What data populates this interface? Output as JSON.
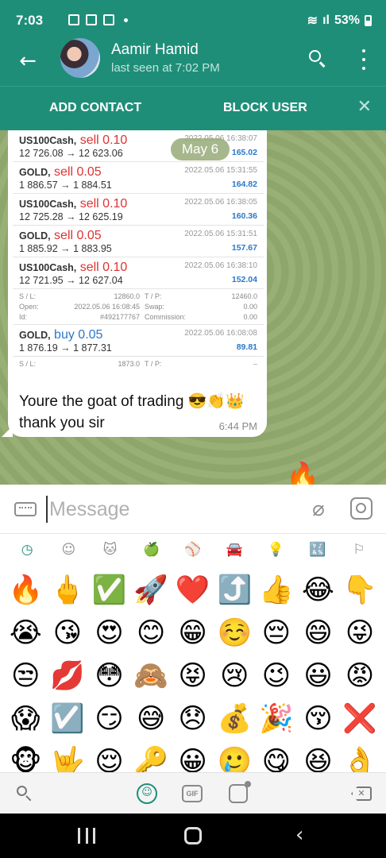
{
  "status_bar": {
    "time": "7:03",
    "battery": "53%"
  },
  "header": {
    "contact_name": "Aamir Hamid",
    "last_seen": "last seen at 7:02 PM"
  },
  "action_bar": {
    "add_contact": "ADD CONTACT",
    "block_user": "BLOCK USER"
  },
  "chat": {
    "date_chip": "May 6",
    "image_trades": [
      {
        "symbol": "US100Cash,",
        "direction": "sell 0.10",
        "prices": "12 726.08 → 12 623.06",
        "time": "2022.05.06 16:38:07",
        "profit": "165.02"
      },
      {
        "symbol": "GOLD,",
        "direction": "sell 0.05",
        "prices": "1 886.57 → 1 884.51",
        "time": "2022.05.06 15:31:55",
        "profit": "164.82"
      },
      {
        "symbol": "US100Cash,",
        "direction": "sell 0.10",
        "prices": "12 725.28 → 12 625.19",
        "time": "2022.05.06 16:38:05",
        "profit": "160.36"
      },
      {
        "symbol": "GOLD,",
        "direction": "sell 0.05",
        "prices": "1 885.92 → 1 883.95",
        "time": "2022.05.06 15:31:51",
        "profit": "157.67"
      },
      {
        "symbol": "US100Cash,",
        "direction": "sell 0.10",
        "prices": "12 721.95 → 12 627.04",
        "time": "2022.05.06 16:38:10",
        "profit": "152.04"
      }
    ],
    "trade_details": {
      "sl_label": "S / L:",
      "sl_value": "12860.0",
      "tp_label": "T / P:",
      "tp_value": "12460.0",
      "open_label": "Open:",
      "open_value": "2022.05.06 16:08:45",
      "swap_label": "Swap:",
      "swap_value": "0.00",
      "id_label": "Id:",
      "id_value": "#492177767",
      "commission_label": "Commission:",
      "commission_value": "0.00"
    },
    "last_trade": {
      "symbol": "GOLD,",
      "direction": "buy 0.05",
      "prices": "1 876.19 → 1 877.31",
      "time": "2022.05.06 16:08:08",
      "profit": "89.81"
    },
    "last_trade_details": {
      "sl_label": "S / L:",
      "sl_value": "1873.0",
      "tp_label": "T / P:",
      "tp_value": "–"
    },
    "message_text": "Youre the goat of trading 😎👏👑thank you sir",
    "message_time": "6:44 PM"
  },
  "composer": {
    "placeholder": "Message"
  },
  "emoji_categories": [
    "recent-icon",
    "smileys-icon",
    "animals-icon",
    "food-icon",
    "activity-icon",
    "travel-icon",
    "objects-icon",
    "symbols-icon",
    "flags-icon"
  ],
  "emoji_categories_glyphs": [
    "◷",
    "☺",
    "🐱",
    "🍏",
    "⚾",
    "🚘",
    "💡",
    "🔣",
    "⚐"
  ],
  "emojis": [
    "🔥",
    "🖕",
    "✅",
    "🚀",
    "❤️",
    "⤴️",
    "👍",
    "😂",
    "👇",
    "😭",
    "😘",
    "😍",
    "😊",
    "😁",
    "☺️",
    "😔",
    "😄",
    "😜",
    "😒",
    "💋",
    "😳",
    "🙈",
    "😝",
    "😢",
    "😉",
    "😃",
    "😡",
    "😱",
    "☑️",
    "😏",
    "😅",
    "😞",
    "💰",
    "🎉",
    "😚",
    "❌",
    "🐵",
    "🤟",
    "😌",
    "🔑",
    "😀",
    "🥲",
    "😋",
    "😆",
    "👌"
  ],
  "keyboard_bar": {
    "gif": "GIF"
  },
  "colors": {
    "brand": "#1f8e79",
    "chat_bg": "#93ab6f"
  }
}
